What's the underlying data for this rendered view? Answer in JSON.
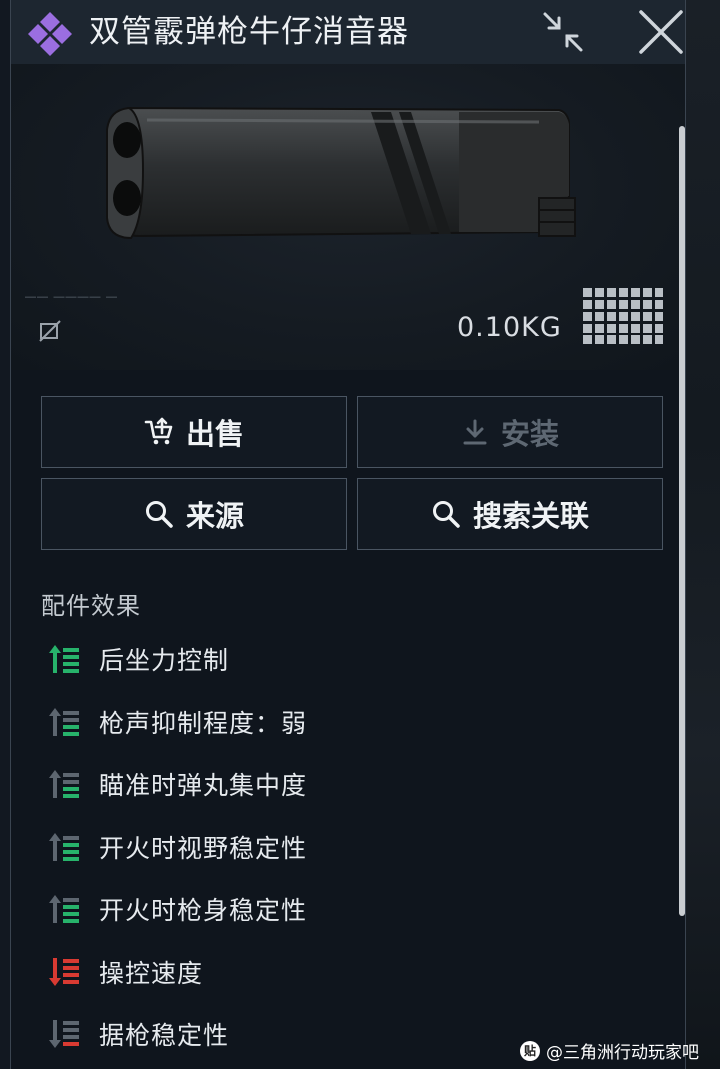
{
  "header": {
    "title": "双管霰弹枪牛仔消音器",
    "logo_icon": "purple-diamond-logo-icon",
    "collapse_icon": "collapse-arrows-icon",
    "close_icon": "close-x-icon"
  },
  "item": {
    "weight": "0.10KG",
    "image": "double-barrel-suppressor",
    "unsellable_icon": "no-trade-icon",
    "size_icon": "slot-grid-icon"
  },
  "actions": {
    "sell": "出售",
    "install": "安装",
    "source": "来源",
    "related": "搜索关联"
  },
  "effects": {
    "title": "配件效果",
    "items": [
      {
        "label": "后坐力控制",
        "level": "positive-high",
        "color": "#27b36b"
      },
      {
        "label": "枪声抑制程度：弱",
        "level": "positive",
        "color": "#27b36b"
      },
      {
        "label": "瞄准时弹丸集中度",
        "level": "positive",
        "color": "#27b36b"
      },
      {
        "label": "开火时视野稳定性",
        "level": "positive",
        "color": "#27b36b"
      },
      {
        "label": "开火时枪身稳定性",
        "level": "positive",
        "color": "#27b36b"
      },
      {
        "label": "操控速度",
        "level": "negative-high",
        "color": "#d83a32"
      },
      {
        "label": "据枪稳定性",
        "level": "negative",
        "color": "#d83a32"
      }
    ]
  },
  "watermark": {
    "text": "@三角洲行动玩家吧",
    "icon_text": "贴"
  },
  "colors": {
    "accent_purple": "#9b6ee0",
    "positive": "#27b36b",
    "negative": "#d83a32"
  }
}
